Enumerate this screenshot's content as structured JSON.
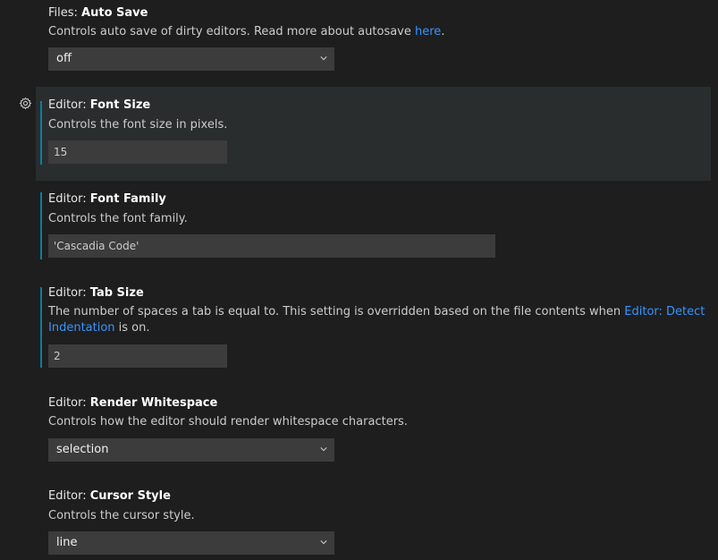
{
  "settings": {
    "auto_save": {
      "category": "Files: ",
      "key": "Auto Save",
      "desc_before": "Controls auto save of dirty editors. Read more about autosave ",
      "desc_link": "here",
      "desc_after": ".",
      "value": "off"
    },
    "font_size": {
      "category": "Editor: ",
      "key": "Font Size",
      "desc": "Controls the font size in pixels.",
      "value": "15"
    },
    "font_family": {
      "category": "Editor: ",
      "key": "Font Family",
      "desc": "Controls the font family.",
      "value": "'Cascadia Code'"
    },
    "tab_size": {
      "category": "Editor: ",
      "key": "Tab Size",
      "desc_before": "The number of spaces a tab is equal to. This setting is overridden based on the file contents when ",
      "desc_link": "Editor: Detect Indentation",
      "desc_after": " is on.",
      "value": "2"
    },
    "render_whitespace": {
      "category": "Editor: ",
      "key": "Render Whitespace",
      "desc": "Controls how the editor should render whitespace characters.",
      "value": "selection"
    },
    "cursor_style": {
      "category": "Editor: ",
      "key": "Cursor Style",
      "desc": "Controls the cursor style.",
      "value": "line"
    }
  },
  "icons": {
    "gear": "gear-icon",
    "chevron": "chevron-down-icon"
  },
  "colors": {
    "background": "#1e1e1e",
    "focused_row": "#2a2d2e",
    "modified_indicator": "#0c7d9d",
    "link": "#3794ff",
    "input_bg": "#3c3c3c"
  }
}
